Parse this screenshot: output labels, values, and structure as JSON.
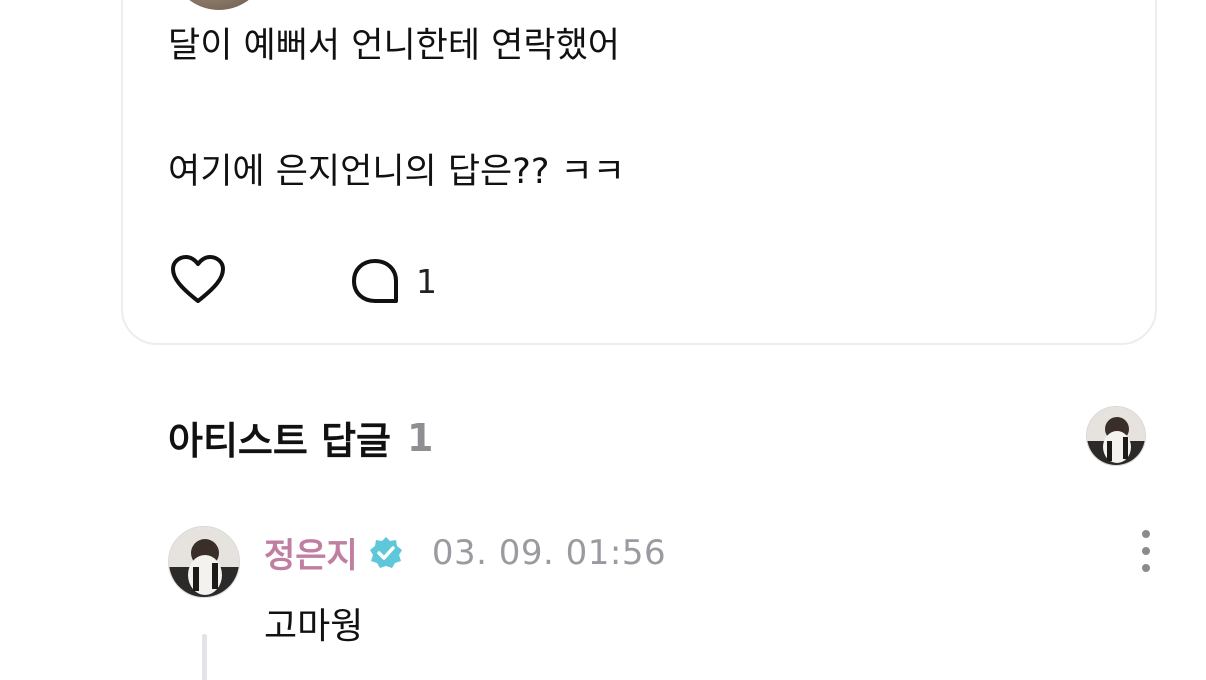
{
  "post": {
    "line1": "달이 예뻐서 언니한테 연락했어",
    "line2": "여기에 은지언니의 답은?? ㅋㅋ",
    "comment_count": "1",
    "like_icon": "heart-icon",
    "comment_icon": "speech-bubble-icon"
  },
  "artist_replies": {
    "title": "아티스트 답글",
    "count": "1"
  },
  "reply": {
    "author": "정은지",
    "verified_icon": "verified-badge-icon",
    "timestamp": "03. 09. 01:56",
    "text": "고마웡",
    "more_icon": "more-vertical-icon"
  },
  "colors": {
    "artist_name": "#c07ea1",
    "verified_badge": "#5ec7d9",
    "muted": "#9a9aa0",
    "card_border": "#ececf1"
  }
}
